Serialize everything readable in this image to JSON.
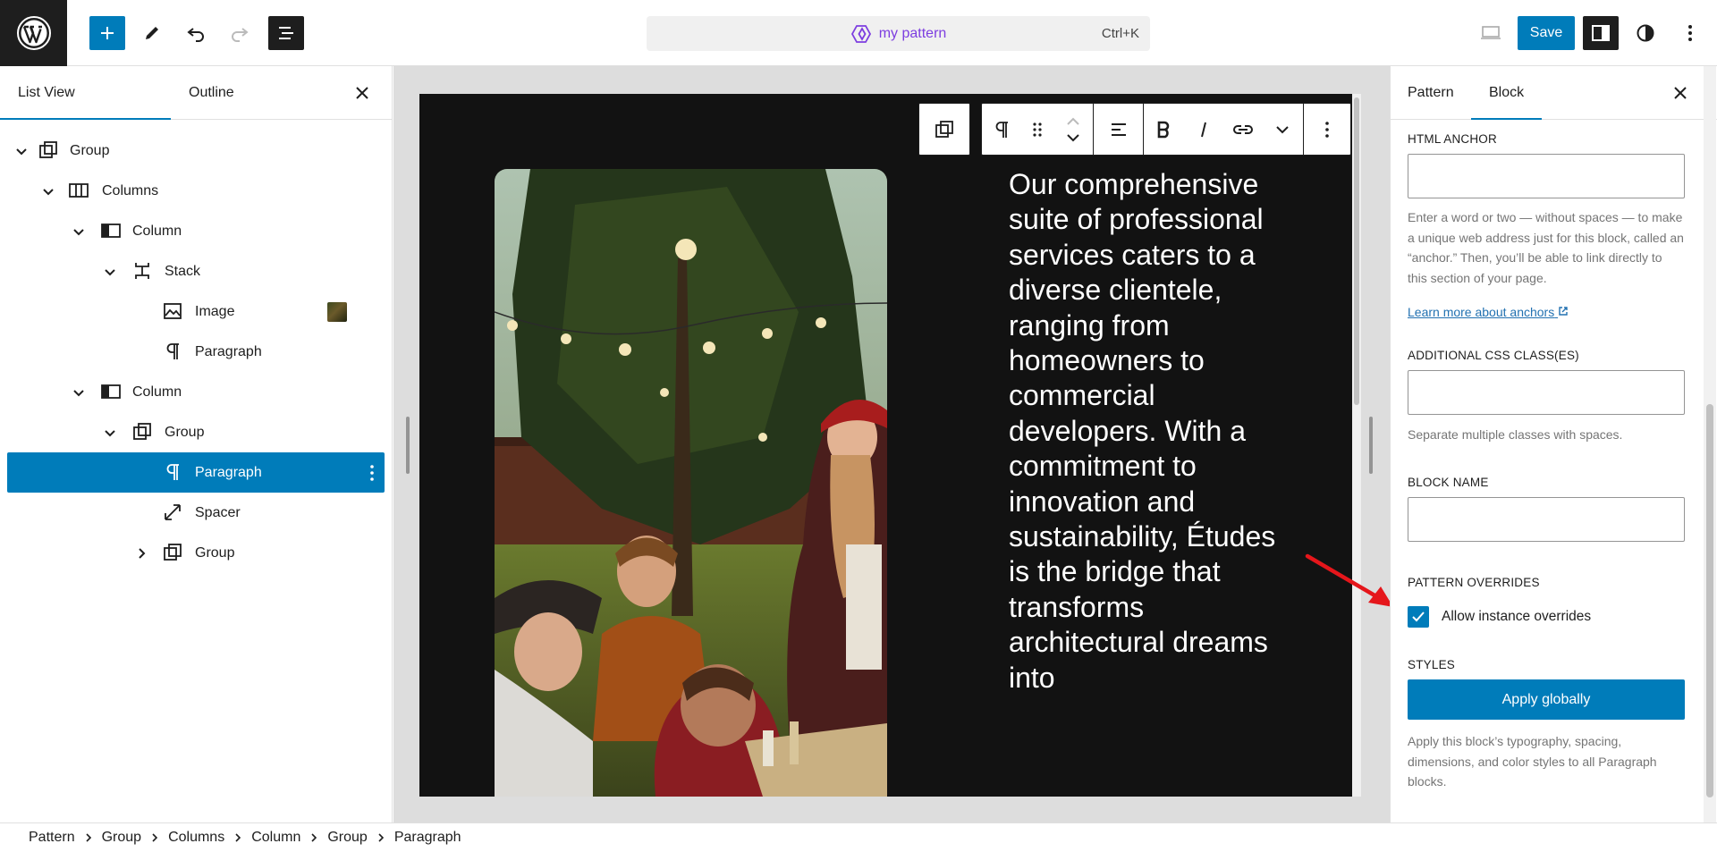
{
  "topbar": {
    "document_title": "my pattern",
    "shortcut": "Ctrl+K",
    "save_label": "Save"
  },
  "left_panel": {
    "tabs": [
      "List View",
      "Outline"
    ],
    "active_tab": "List View",
    "tree": [
      {
        "label": "Group",
        "icon": "group-icon",
        "expanded": true
      },
      {
        "label": "Columns",
        "icon": "columns-icon",
        "expanded": true
      },
      {
        "label": "Column",
        "icon": "column-icon",
        "expanded": true
      },
      {
        "label": "Stack",
        "icon": "stack-icon",
        "expanded": true
      },
      {
        "label": "Image",
        "icon": "image-icon"
      },
      {
        "label": "Paragraph",
        "icon": "paragraph-icon"
      },
      {
        "label": "Column",
        "icon": "column-icon",
        "expanded": true
      },
      {
        "label": "Group",
        "icon": "group-icon",
        "expanded": true
      },
      {
        "label": "Paragraph",
        "icon": "paragraph-icon",
        "selected": true
      },
      {
        "label": "Spacer",
        "icon": "spacer-icon"
      },
      {
        "label": "Group",
        "icon": "group-icon",
        "expanded": false
      }
    ]
  },
  "canvas": {
    "hero_text": "Our comprehensive suite of professional services caters to a diverse clientele, ranging from homeowners to commercial developers. With a commitment to innovation and sustainability, Études is the bridge that transforms architectural dreams into",
    "frame_color": "#121212"
  },
  "right_panel": {
    "tabs": [
      "Pattern",
      "Block"
    ],
    "active_tab": "Block",
    "html_anchor": {
      "label": "HTML ANCHOR",
      "value": "",
      "help": "Enter a word or two — without spaces — to make a unique web address just for this block, called an “anchor.” Then, you’ll be able to link directly to this section of your page.",
      "link": "Learn more about anchors"
    },
    "css_classes": {
      "label": "ADDITIONAL CSS CLASS(ES)",
      "value": "",
      "help": "Separate multiple classes with spaces."
    },
    "block_name": {
      "label": "BLOCK NAME",
      "value": ""
    },
    "pattern_overrides": {
      "label": "PATTERN OVERRIDES",
      "checkbox_label": "Allow instance overrides",
      "checked": true
    },
    "styles": {
      "label": "STYLES",
      "button": "Apply globally",
      "help": "Apply this block’s typography, spacing, dimensions, and color styles to all Paragraph blocks."
    }
  },
  "breadcrumbs": [
    "Pattern",
    "Group",
    "Columns",
    "Column",
    "Group",
    "Paragraph"
  ],
  "colors": {
    "accent": "#007cba",
    "pattern_purple": "#7d3ee0",
    "annotation_arrow": "#e5161b"
  }
}
